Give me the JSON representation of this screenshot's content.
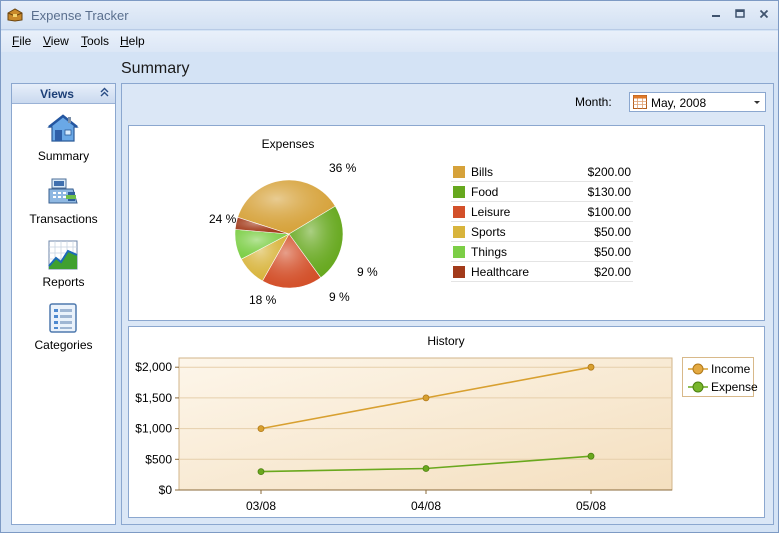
{
  "window": {
    "title": "Expense Tracker"
  },
  "menu": {
    "file": {
      "u": "F",
      "rest": "ile"
    },
    "view": {
      "u": "V",
      "rest": "iew"
    },
    "tools": {
      "u": "T",
      "rest": "ools"
    },
    "help": {
      "u": "H",
      "rest": "elp"
    }
  },
  "page_title": "Summary",
  "sidebar": {
    "header": "Views",
    "items": [
      {
        "label": "Summary",
        "icon": "home-icon"
      },
      {
        "label": "Transactions",
        "icon": "cash-register-icon"
      },
      {
        "label": "Reports",
        "icon": "report-chart-icon"
      },
      {
        "label": "Categories",
        "icon": "categories-list-icon"
      }
    ]
  },
  "month": {
    "label": "Month:",
    "value": "May, 2008"
  },
  "colors": {
    "bills": "#d6a23a",
    "food": "#66a81e",
    "leisure": "#d3502a",
    "sports": "#d8b43c",
    "things": "#7cce46",
    "healthcare": "#a23a1a",
    "income_line": "#d8a030",
    "expense_line": "#6aa81e"
  },
  "chart_data": [
    {
      "type": "pie",
      "title": "Expenses",
      "categories": [
        "Bills",
        "Food",
        "Leisure",
        "Sports",
        "Things",
        "Healthcare"
      ],
      "values": [
        200,
        130,
        100,
        50,
        50,
        20
      ],
      "amounts": [
        "$200.00",
        "$130.00",
        "$100.00",
        "$50.00",
        "$50.00",
        "$20.00"
      ],
      "slice_labels": [
        "36 %",
        "24 %",
        "18 %",
        "9 %",
        "9 %",
        ""
      ],
      "legend": "right"
    },
    {
      "type": "line",
      "title": "History",
      "x": [
        "03/08",
        "04/08",
        "05/08"
      ],
      "series": [
        {
          "name": "Income",
          "values": [
            1000,
            1500,
            2000
          ]
        },
        {
          "name": "Expense",
          "values": [
            300,
            350,
            550
          ]
        }
      ],
      "ylim": [
        0,
        2150
      ],
      "yticks": [
        0,
        500,
        1000,
        1500,
        2000
      ],
      "ytick_labels": [
        "$0",
        "$500",
        "$1,000",
        "$1,500",
        "$2,000"
      ],
      "grid": true,
      "legend": "right"
    }
  ]
}
